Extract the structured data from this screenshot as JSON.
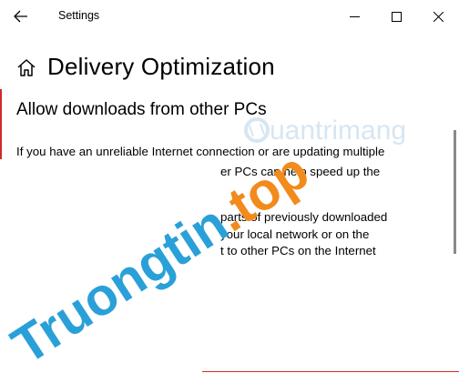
{
  "window": {
    "title": "Settings"
  },
  "header": {
    "title": "Delivery Optimization"
  },
  "content": {
    "section_title": "Allow downloads from other PCs",
    "paragraph1_line1": "If you have an unreliable Internet connection or are updating multiple",
    "paragraph1_line2": "er PCs can help speed up the",
    "paragraph2_line1": "parts of previously downloaded",
    "paragraph2_line2": "your local network or on the",
    "paragraph2_line3": "t to other PCs on the Internet"
  },
  "watermark": {
    "text": "Truongtin.top",
    "logo_text": "uantrimang"
  },
  "colors": {
    "accent_red": "#d02a2a",
    "watermark_blue": "#2aa0d8",
    "watermark_orange": "#f28a1c"
  }
}
